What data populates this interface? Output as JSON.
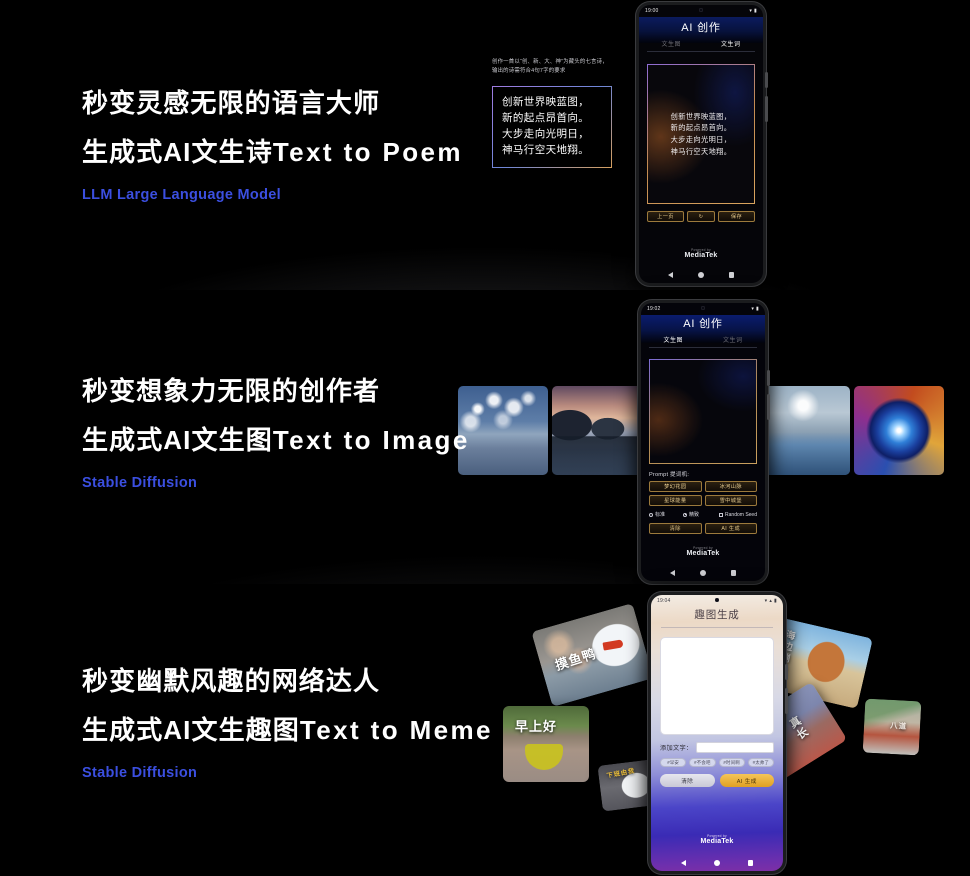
{
  "sections": [
    {
      "id": "text-to-poem",
      "headline_cn": "秒变灵感无限的语言大师",
      "headline_cn2": "生成式AI文生诗",
      "headline_en": "Text to Poem",
      "subtitle": "LLM Large Language Model",
      "accent_color": "#3b4fe0",
      "callout": {
        "note": "创作一首以“创、新、大、神”为藏头的七言诗，输出的诗需符合4句7字的要求",
        "poem_lines": [
          "创新世界映蓝图，",
          "新的起点昂首向。",
          "大步走向光明日，",
          "神马行空天地翔。"
        ]
      },
      "phone": {
        "status_time": "19:00",
        "status_icons": [
          "wifi-icon",
          "signal-icon",
          "battery-icon"
        ],
        "app_title": "AI 创作",
        "tabs": [
          {
            "label": "文生图",
            "active": false
          },
          {
            "label": "文生词",
            "active": true
          }
        ],
        "poem_output": [
          "创新世界映蓝图，",
          "新的起点昂首向。",
          "大步走向光明日，",
          "神马行空天地翔。"
        ],
        "buttons": [
          {
            "label": "上一页",
            "name": "prev-page-button"
          },
          {
            "label": "↻",
            "name": "refresh-button"
          },
          {
            "label": "保存",
            "name": "save-button"
          }
        ],
        "footer_powered": "Powered by",
        "footer_brand": "MediaTek"
      }
    },
    {
      "id": "text-to-image",
      "headline_cn": "秒变想象力无限的创作者",
      "headline_cn2": "生成式AI文生图",
      "headline_en": "Text to Image",
      "subtitle": "Stable Diffusion",
      "accent_color": "#3b4fe0",
      "thumbnails": [
        {
          "name": "thumbnail-clouds-over-water",
          "style": "img-clouds"
        },
        {
          "name": "thumbnail-mountain-reflection",
          "style": "img-mountain"
        },
        {
          "name": "thumbnail-icy-river-valley",
          "style": "img-icy"
        },
        {
          "name": "thumbnail-cosmic-vortex",
          "style": "img-vortex"
        }
      ],
      "phone": {
        "status_time": "19:02",
        "app_title": "AI 创作",
        "tabs": [
          {
            "label": "文生图",
            "active": true
          },
          {
            "label": "文生词",
            "active": false
          }
        ],
        "prompt_label": "Prompt 提词机:",
        "prompt_presets": [
          "梦幻花园",
          "冰河山脉",
          "星球能量",
          "雪中城堡"
        ],
        "quality_options": [
          {
            "label": "标准",
            "selected": false,
            "control": "radio"
          },
          {
            "label": "精致",
            "selected": true,
            "control": "radio"
          },
          {
            "label": "Random Seed",
            "selected": false,
            "control": "checkbox"
          }
        ],
        "buttons": [
          {
            "label": "清除",
            "name": "clear-button"
          },
          {
            "label": "AI 生成",
            "name": "ai-generate-button"
          }
        ],
        "footer_powered": "Powered by",
        "footer_brand": "MediaTek"
      }
    },
    {
      "id": "text-to-meme",
      "headline_cn": "秒变幽默风趣的网络达人",
      "headline_cn2": "生成式AI文生趣图",
      "headline_en": "Text to Meme",
      "subtitle": "Stable Diffusion",
      "accent_color": "#3b4fe0",
      "meme_cards": [
        {
          "name": "meme-card-duck-large",
          "caption": "摸鱼鸭"
        },
        {
          "name": "meme-card-tea-bowl",
          "caption": "早上好"
        },
        {
          "name": "meme-card-duck-small",
          "caption": "下班由我"
        },
        {
          "name": "meme-card-corgi-dog",
          "caption": "海边蹦迪"
        },
        {
          "name": "meme-card-carrot",
          "caption": "真长"
        },
        {
          "name": "meme-card-carrot-small",
          "caption": "八道"
        }
      ],
      "phone": {
        "status_time": "19:04",
        "app_title": "趣图生成",
        "add_text_label": "添加文字：",
        "add_text_value": "",
        "tags": [
          "#早安",
          "#不会吧",
          "#时间啊",
          "#太帅了"
        ],
        "buttons": [
          {
            "label": "清除",
            "name": "clear-button"
          },
          {
            "label": "AI 生成",
            "name": "ai-generate-button"
          }
        ],
        "footer_powered": "Powered by",
        "footer_brand": "MediaTek"
      }
    }
  ]
}
